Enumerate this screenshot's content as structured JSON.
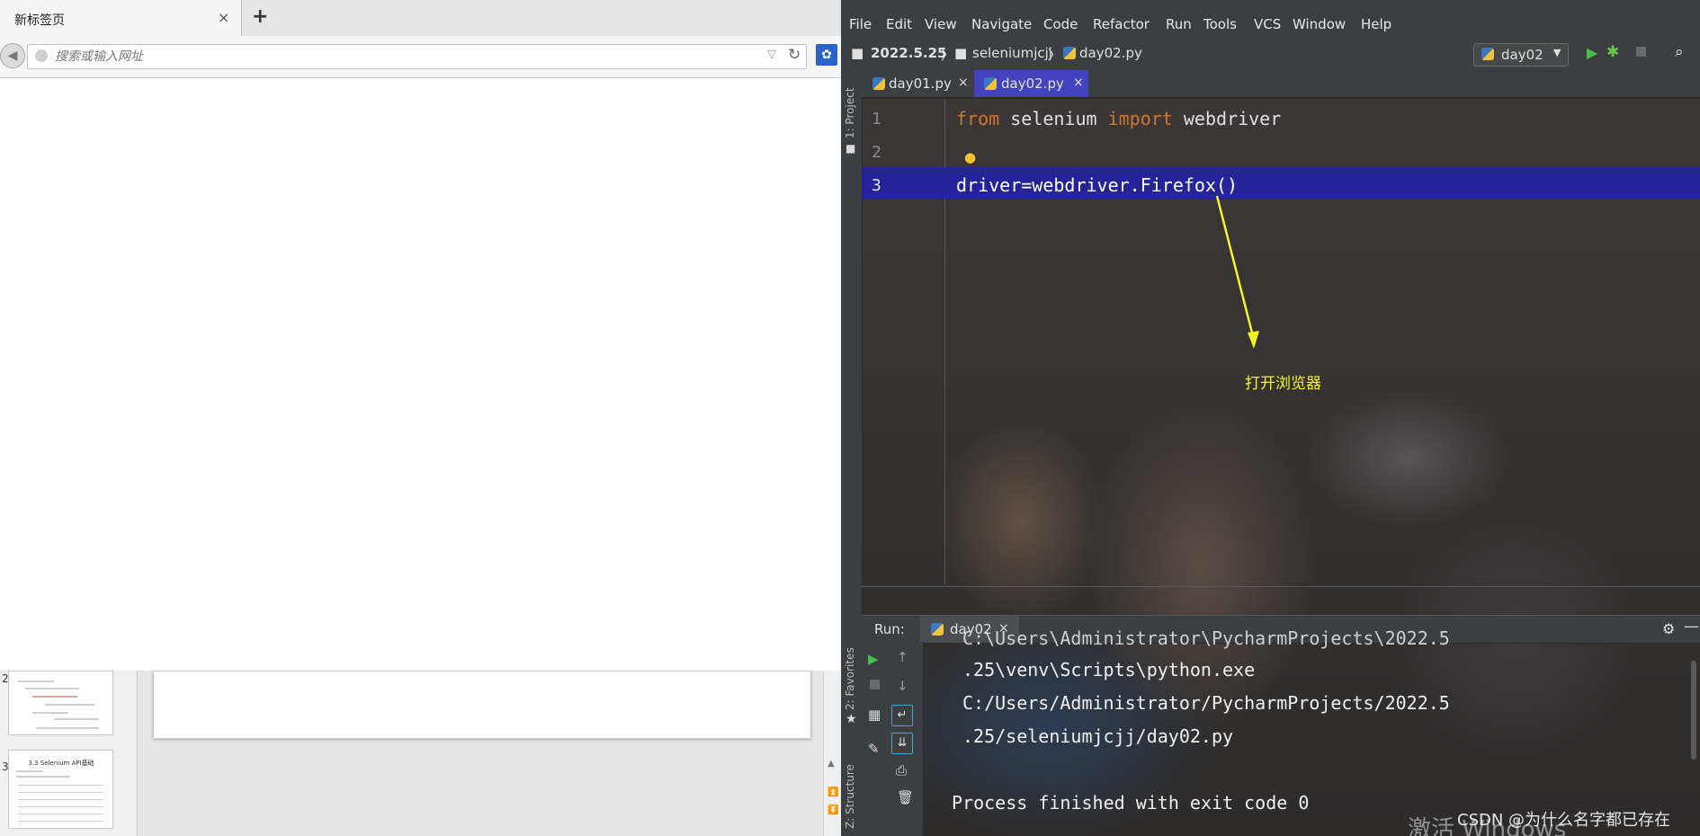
{
  "firefox": {
    "tab_title": "新标签页",
    "tab_close": "×",
    "new_tab": "+",
    "url_placeholder": "搜索或输入网址",
    "back_icon": "arrow-left-icon",
    "reload_icon": "reload-icon"
  },
  "ppt": {
    "thumb_numbers": [
      "2",
      "3"
    ],
    "thumb3_title": "3.3 Selenium API基础"
  },
  "pycharm": {
    "menu": [
      "File",
      "Edit",
      "View",
      "Navigate",
      "Code",
      "Refactor",
      "Run",
      "Tools",
      "VCS",
      "Window",
      "Help"
    ],
    "breadcrumb": [
      "2022.5.25",
      "seleniumjcjj",
      "day02.py"
    ],
    "run_config": "day02",
    "side_labels": {
      "project": "1: Project",
      "favorites": "2: Favorites",
      "structure": "Z: Structure"
    },
    "editor_tabs": [
      {
        "label": "day01.py",
        "active": false
      },
      {
        "label": "day02.py",
        "active": true
      }
    ],
    "tab_close": "×",
    "line_numbers": [
      "1",
      "2",
      "3"
    ],
    "code": {
      "line1_kw1": "from",
      "line1_mod": " selenium ",
      "line1_kw2": "import",
      "line1_name": " webdriver",
      "line3": "driver=webdriver.Firefox()"
    },
    "annotation": "打开浏览器",
    "run": {
      "title": "Run:",
      "tab": "day02",
      "output": [
        "C:\\Users\\Administrator\\PycharmProjects\\2022.5",
        ".25\\venv\\Scripts\\python.exe",
        "C:/Users/Administrator/PycharmProjects/2022.5",
        ".25/seleniumjcjj/day02.py",
        "",
        "Process finished with exit code 0"
      ]
    },
    "watermark": "激活 Windows",
    "csdn_credit": "CSDN @为什么名字都已存在"
  }
}
